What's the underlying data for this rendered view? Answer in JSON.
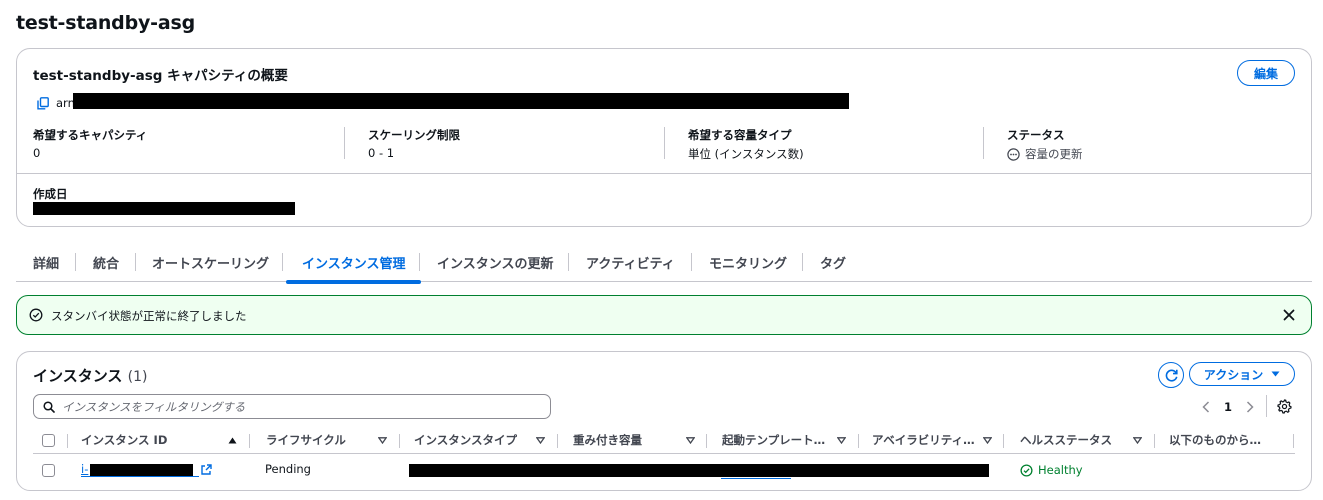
{
  "page": {
    "title": "test-standby-asg"
  },
  "summary": {
    "title": "test-standby-asg キャパシティの概要",
    "edit_label": "編集",
    "arn_label": "arn:",
    "fields": [
      {
        "key": "希望するキャパシティ",
        "value": "0"
      },
      {
        "key": "スケーリング制限",
        "value": "0 - 1"
      },
      {
        "key": "希望する容量タイプ",
        "value": "単位 (インスタンス数)"
      },
      {
        "key": "ステータス",
        "value": "容量の更新"
      }
    ],
    "created_label": "作成日"
  },
  "tabs": [
    {
      "label": "詳細"
    },
    {
      "label": "統合"
    },
    {
      "label": "オートスケーリング"
    },
    {
      "label": "インスタンス管理",
      "active": true
    },
    {
      "label": "インスタンスの更新"
    },
    {
      "label": "アクティビティ"
    },
    {
      "label": "モニタリング"
    },
    {
      "label": "タグ"
    }
  ],
  "flash": {
    "message": "スタンバイ状態が正常に終了しました",
    "type": "success"
  },
  "instances": {
    "title": "インスタンス",
    "count": "(1)",
    "action_label": "アクション",
    "search_placeholder": "インスタンスをフィルタリングする",
    "page_number": "1",
    "columns": [
      "インスタンス ID",
      "ライフサイクル",
      "インスタンスタイプ",
      "重み付き容量",
      "起動テンプレート…",
      "アベイラビリティ…",
      "ヘルスステータス",
      "以下のものから…"
    ],
    "rows": [
      {
        "instance_id": "i-",
        "lifecycle": "Pending",
        "health": "Healthy"
      }
    ]
  },
  "colors": {
    "accent": "#006ce0",
    "success": "#00802f",
    "success_bg": "#effff1",
    "border": "#c6c6cd"
  },
  "icons": [
    "copy-icon",
    "status-in-progress-icon",
    "check-circle-icon",
    "close-icon",
    "refresh-icon",
    "caret-down-icon",
    "search-icon",
    "chevron-left-icon",
    "chevron-right-icon",
    "gear-icon",
    "external-link-icon",
    "sort-ascending-icon",
    "sort-icon"
  ]
}
